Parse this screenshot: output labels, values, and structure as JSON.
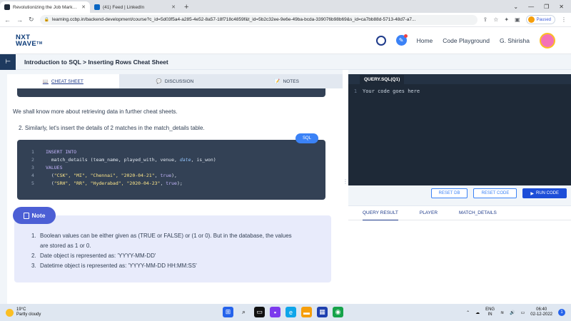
{
  "browser": {
    "tabs": [
      {
        "title": "Revolutionizing the Job Market |",
        "icon_color": "#1f2937"
      },
      {
        "title": "(41) Feed | LinkedIn",
        "icon_color": "#0a66c2"
      }
    ],
    "new_tab": "+",
    "url": "learning.ccbp.in/backend-development/course?c_id=5d03f5a4-a285-4e52-8a57-18f718c4859f&t_id=5b2c32ee-9e6e-49ba-bcda-339076b98b69&s_id=ca7bb88d-5713-48d7-a7...",
    "profile_status": "Paused"
  },
  "header": {
    "logo_line1": "NXT",
    "logo_line2": "WAVE",
    "logo_suffix": "TM",
    "nav": [
      "Home",
      "Code Playground"
    ],
    "user_name": "G. Shirisha"
  },
  "breadcrumb": "Introduction to SQL > Inserting Rows Cheat Sheet",
  "left_tabs": [
    "CHEAT SHEET",
    "DISCUSSION",
    "NOTES"
  ],
  "content": {
    "paragraph": "We shall know more about retrieving data in further cheat sheets.",
    "step": "2. Similarly, let's insert the details of 2 matches in the match_details table.",
    "sql_badge": "SQL",
    "code": {
      "line_numbers": [
        "1",
        "2",
        "3",
        "4",
        "5"
      ],
      "l1_kw": "INSERT INTO",
      "l2_a": "  match_details (team_name, played_with, venue, ",
      "l2_date": "date",
      "l2_b": ", is_won)",
      "l3_kw": "VALUES",
      "l4_a": "  (",
      "l4_str": "\"CSK\", \"MI\", \"Chennai\", \"2020-04-21\"",
      "l4_b": ", ",
      "l4_true": "true",
      "l4_c": "),",
      "l5_a": "  (",
      "l5_str": "\"SRH\", \"RR\", \"Hyderabad\", \"2020-04-23\"",
      "l5_b": ", ",
      "l5_true": "true",
      "l5_c": ");"
    },
    "note": {
      "title": "Note",
      "items": [
        {
          "n": "1.",
          "text": "Boolean values can be either given as (TRUE or FALSE) or (1 or 0). But in the database, the values"
        },
        {
          "n": "",
          "text": "are stored as 1 or 0."
        },
        {
          "n": "2.",
          "text": "Date object is represented as: 'YYYY-MM-DD'"
        },
        {
          "n": "3.",
          "text": "Datetime object is represented as: 'YYYY-MM-DD HH:MM:SS'"
        }
      ]
    }
  },
  "editor": {
    "tab": "QUERY.SQL(Q1)",
    "line_number": "1",
    "placeholder": "Your code goes here"
  },
  "actions": {
    "reset_db": "RESET DB",
    "reset_code": "RESET CODE",
    "run_code": "RUN CODE"
  },
  "result_tabs": [
    "QUERY RESULT",
    "PLAYER",
    "MATCH_DETAILS"
  ],
  "taskbar": {
    "temperature": "19°C",
    "weather": "Partly cloudy",
    "lang_line1": "ENG",
    "lang_line2": "IN",
    "time": "06:40",
    "date": "02-12-2022",
    "notif_count": "1"
  },
  "colors": {
    "accent": "#3b82f6",
    "brand_dark": "#1e3a5f",
    "note_bg": "#e8ebfb",
    "note_badge": "#4c5fd5",
    "code_bg": "#334155",
    "editor_bg": "#1e2937"
  }
}
